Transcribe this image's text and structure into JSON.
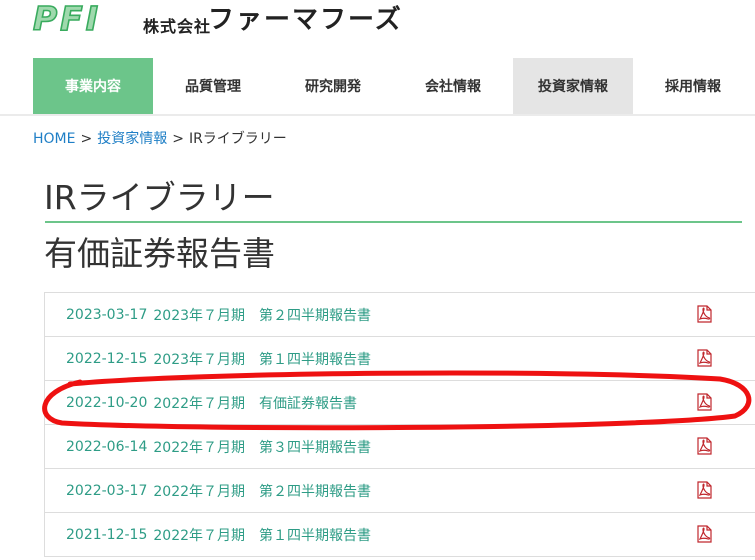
{
  "header": {
    "logo_text": "PFI",
    "company_prefix": "株式会社",
    "company_name": "ファーマフーズ"
  },
  "nav": {
    "items": [
      {
        "label": "事業内容"
      },
      {
        "label": "品質管理"
      },
      {
        "label": "研究開発"
      },
      {
        "label": "会社情報"
      },
      {
        "label": "投資家情報"
      },
      {
        "label": "採用情報"
      }
    ]
  },
  "breadcrumb": {
    "home": "HOME",
    "separator": ">",
    "parent": "投資家情報",
    "current": "IRライブラリー"
  },
  "page_title": "IRライブラリー",
  "section_title": "有価証券報告書",
  "reports": [
    {
      "date": "2023-03-17",
      "title": "2023年７月期　第２四半期報告書",
      "icon": "pdf-icon"
    },
    {
      "date": "2022-12-15",
      "title": "2023年７月期　第１四半期報告書",
      "icon": "pdf-icon"
    },
    {
      "date": "2022-10-20",
      "title": "2022年７月期　有価証券報告書",
      "icon": "pdf-icon"
    },
    {
      "date": "2022-06-14",
      "title": "2022年７月期　第３四半期報告書",
      "icon": "pdf-icon"
    },
    {
      "date": "2022-03-17",
      "title": "2022年７月期　第２四半期報告書",
      "icon": "pdf-icon"
    },
    {
      "date": "2021-12-15",
      "title": "2022年７月期　第１四半期報告書",
      "icon": "pdf-icon"
    }
  ],
  "colors": {
    "brand_green": "#6cc58a",
    "brand_green_dark": "#39ab5e",
    "logo_fill": "#9fd9ad",
    "nav_active_bg": "#6cc58a",
    "nav_current_bg": "#e5e5e5",
    "link_blue": "#1f7fc6",
    "report_link": "#2e9c86",
    "pdf_red": "#c0272d",
    "annotation_red": "#ee1111"
  }
}
